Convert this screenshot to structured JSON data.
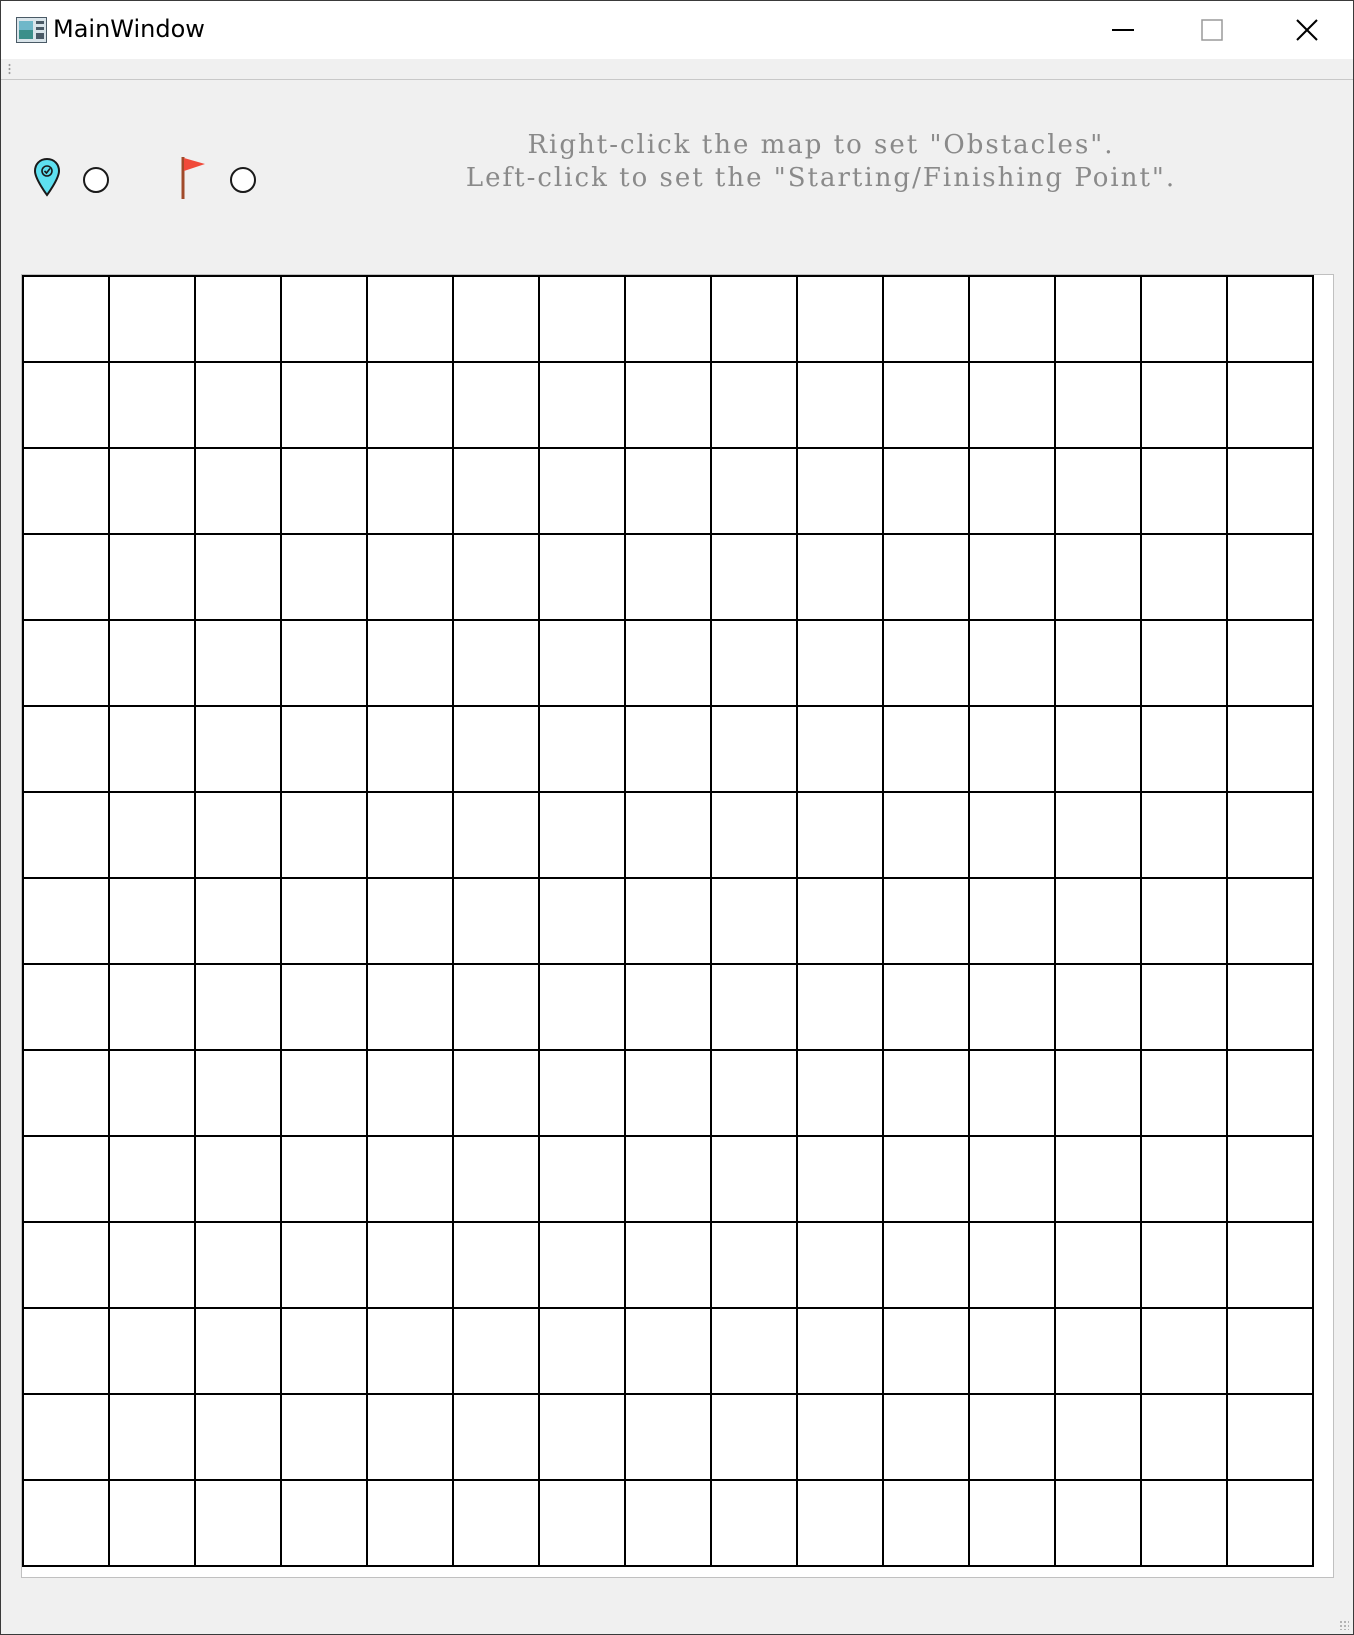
{
  "window": {
    "title": "MainWindow",
    "app_icon": "app-window-icon",
    "controls": [
      "minimize-icon",
      "maximize-icon",
      "close-icon"
    ]
  },
  "legend": {
    "start": {
      "icon": "location-pin-icon",
      "color": "#5ee0f0",
      "selected": false
    },
    "finish": {
      "icon": "flag-icon",
      "color": "#f04a3a",
      "selected": false
    }
  },
  "instructions": {
    "line1": "Right-click the map to set \"Obstacles\".",
    "line2": "Left-click to set the \"Starting/Finishing Point\"."
  },
  "map": {
    "rows": 15,
    "columns": 15,
    "cell_color": "#ffffff",
    "line_color": "#000000"
  }
}
